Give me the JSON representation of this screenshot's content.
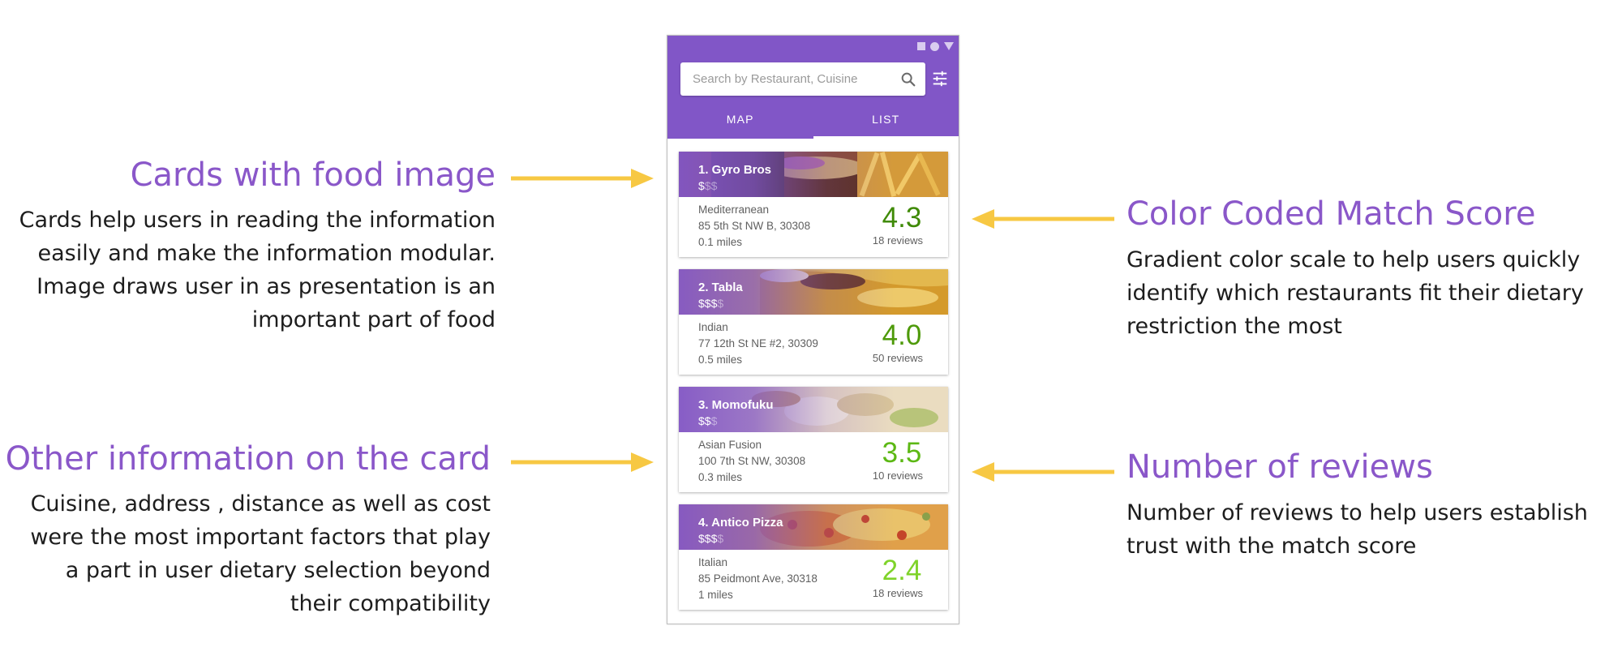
{
  "annotations": {
    "cards_food_image": {
      "title": "Cards with food image",
      "body": [
        "Cards help users in reading the information",
        "easily and make the information modular.",
        "Image draws user in as presentation is an",
        "important part of food"
      ]
    },
    "other_info": {
      "title": "Other information on the card",
      "body": [
        "Cuisine, address , distance as well as cost",
        "were the most important factors that play",
        "a part in user dietary selection beyond",
        "their compatibility"
      ]
    },
    "match_score": {
      "title": "Color Coded Match Score",
      "body": [
        "Gradient color scale to help users quickly",
        "identify which restaurants fit their dietary",
        "restriction the most"
      ]
    },
    "reviews": {
      "title": "Number of reviews",
      "body": [
        "Number of reviews to help users establish",
        "trust with the match score"
      ]
    }
  },
  "app": {
    "search": {
      "placeholder": "Search by Restaurant, Cuisine",
      "icon": "search-icon"
    },
    "filter_icon": "tune-icon",
    "tabs": [
      {
        "label": "MAP",
        "active": false
      },
      {
        "label": "LIST",
        "active": true
      }
    ],
    "restaurants": [
      {
        "name": "1. Gyro Bros",
        "cost_level": 1,
        "cost_max": 3,
        "cuisine": "Mediterranean",
        "address": "85 5th St NW B, 30308",
        "distance": "0.1 miles",
        "score": "4.3",
        "score_color": "#3f8a06",
        "reviews": "18 reviews"
      },
      {
        "name": "2. Tabla",
        "cost_level": 3,
        "cost_max": 4,
        "cuisine": "Indian",
        "address": "77 12th St NE #2, 30309",
        "distance": "0.5 miles",
        "score": "4.0",
        "score_color": "#4e9a0a",
        "reviews": "50 reviews"
      },
      {
        "name": "3. Momofuku",
        "cost_level": 2,
        "cost_max": 3,
        "cuisine": "Asian Fusion",
        "address": "100 7th St NW, 30308",
        "distance": "0.3 miles",
        "score": "3.5",
        "score_color": "#5cb814",
        "reviews": "10 reviews"
      },
      {
        "name": "4. Antico Pizza",
        "cost_level": 3,
        "cost_max": 4,
        "cuisine": "Italian",
        "address": "85 Peidmont Ave, 30318",
        "distance": "1 miles",
        "score": "2.4",
        "score_color": "#7fd32a",
        "reviews": "18 reviews"
      }
    ]
  },
  "colors": {
    "accent": "#8156c7",
    "annotation_title": "#8a57c9",
    "arrow": "#f7c843"
  }
}
